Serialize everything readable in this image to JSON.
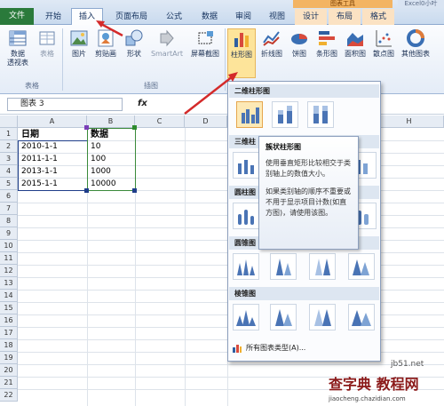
{
  "tabs": {
    "file": "文件",
    "home": "开始",
    "insert": "插入",
    "page_layout": "页面布局",
    "formulas": "公式",
    "data": "数据",
    "review": "审阅",
    "view": "视图",
    "design": "设计",
    "layout": "布局",
    "format": "格式",
    "context_header": "图表工具",
    "window_title_partial": "Excel0小叶"
  },
  "ribbon": {
    "pivot_label": "数据\n透视表",
    "table_label": "表格",
    "picture_label": "图片",
    "clipart_label": "剪贴画",
    "shapes_label": "形状",
    "smartart_label": "SmartArt",
    "screenshot_label": "屏幕截图",
    "column_label": "柱形图",
    "line_label": "折线图",
    "pie_label": "饼图",
    "bar_label": "条形图",
    "area_label": "面积图",
    "scatter_label": "散点图",
    "other_label": "其他图表",
    "group_tables": "表格",
    "group_illustrations": "插图"
  },
  "formula_bar": {
    "name_box": "图表 3",
    "fx": "fx"
  },
  "grid": {
    "columns": [
      "A",
      "B",
      "C",
      "D",
      "E",
      "F",
      "G",
      "H"
    ],
    "rows": [
      "1",
      "2",
      "3",
      "4",
      "5",
      "6",
      "7",
      "8",
      "9",
      "10",
      "11",
      "12",
      "13",
      "14",
      "15",
      "16",
      "17",
      "18",
      "19",
      "20",
      "21",
      "22"
    ],
    "cells": {
      "A1": "日期",
      "B1": "数据",
      "A2": "2010-1-1",
      "B2": "10",
      "A3": "2011-1-1",
      "B3": "100",
      "A4": "2013-1-1",
      "B4": "1000",
      "A5": "2015-1-1",
      "B5": "10000"
    }
  },
  "dropdown": {
    "section_2d": "二维柱形图",
    "section_3d": "三维柱",
    "section_cylinder": "圆柱图",
    "section_cone": "圆锥图",
    "section_pyramid": "棱锥图",
    "footer": "所有图表类型(A)..."
  },
  "tooltip": {
    "title": "簇状柱形图",
    "body1": "使用垂直矩形比较相交于类别轴上的数值大小。",
    "body2": "如果类别轴的顺序不重要或不用于显示项目计数(如直方图)，请使用该图。"
  },
  "watermark": {
    "site": "jb51.net",
    "text": "查字典 教程网",
    "url": "jiaocheng.chazidian.com"
  },
  "colors": {
    "file_tab": "#2a7a3b",
    "context_tab": "#f3b463",
    "arrow": "#d42a2a",
    "highlight": "#fde49a"
  }
}
